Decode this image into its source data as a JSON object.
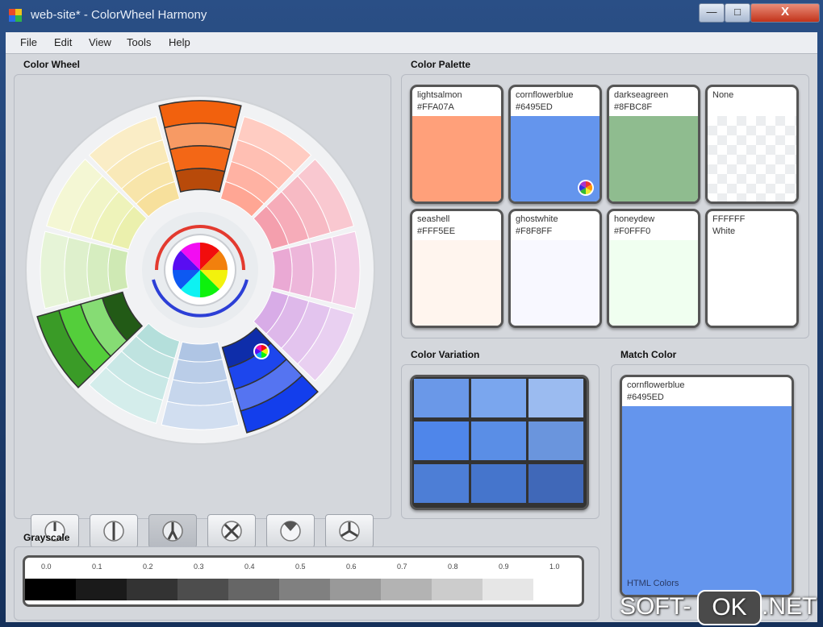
{
  "window": {
    "title": "web-site* - ColorWheel Harmony",
    "minimize": "—",
    "maximize": "□",
    "close": "X"
  },
  "menu": [
    "File",
    "Edit",
    "View",
    "Tools",
    "Help"
  ],
  "color_wheel": {
    "title": "Color Wheel"
  },
  "palette": {
    "title": "Color Palette",
    "swatches": [
      {
        "name": "lightsalmon",
        "hex": "#FFA07A",
        "color": "#FFA07A"
      },
      {
        "name": "cornflowerblue",
        "hex": "#6495ED",
        "color": "#6495ED"
      },
      {
        "name": "darkseagreen",
        "hex": "#8FBC8F",
        "color": "#8FBC8F"
      },
      {
        "name": "None",
        "hex": "",
        "color": ""
      },
      {
        "name": "seashell",
        "hex": "#FFF5EE",
        "color": "#FFF5EE"
      },
      {
        "name": "ghostwhite",
        "hex": "#F8F8FF",
        "color": "#F8F8FF"
      },
      {
        "name": "honeydew",
        "hex": "#F0FFF0",
        "color": "#F0FFF0"
      },
      {
        "name": "FFFFFF",
        "hex": "White",
        "color": "#FFFFFF"
      }
    ]
  },
  "variation": {
    "title": "Color Variation",
    "colors": [
      "#6a98e8",
      "#7aa6ee",
      "#9bbbf0",
      "#4f86ea",
      "#5a8ee6",
      "#6a95dd",
      "#4d7ed6",
      "#4575cc",
      "#4068b8"
    ]
  },
  "match": {
    "title": "Match Color",
    "name": "cornflowerblue",
    "hex": "#6495ED",
    "color": "#6495ED",
    "footer": "HTML Colors"
  },
  "grayscale": {
    "title": "Grayscale",
    "ticks": [
      "0.0",
      "0.1",
      "0.2",
      "0.3",
      "0.4",
      "0.5",
      "0.6",
      "0.7",
      "0.8",
      "0.9",
      "1.0"
    ]
  },
  "watermark": {
    "part1": "SOFT-",
    "part2": "OK",
    "part3": ".NET"
  },
  "accent": {
    "wheel_top": "#e9531a",
    "wheel_green": "#4a8f2e",
    "wheel_blue": "#2446d8"
  }
}
